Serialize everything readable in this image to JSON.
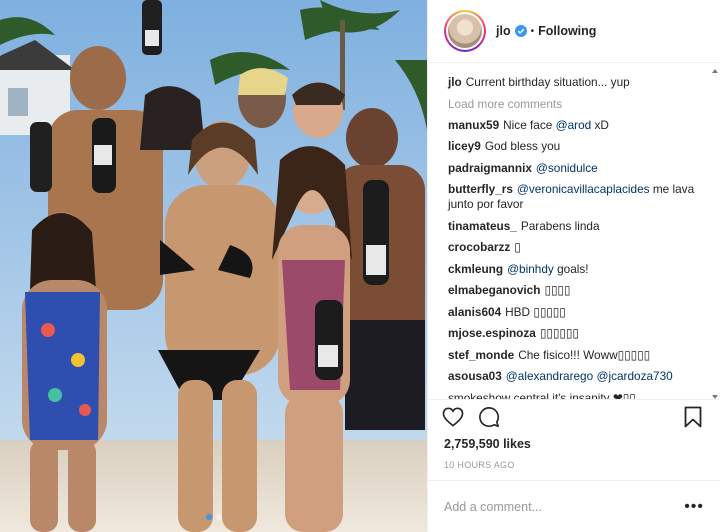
{
  "header": {
    "username": "jlo",
    "separator": "•",
    "follow_status": "Following"
  },
  "caption": {
    "username": "jlo",
    "text": "Current birthday situation... yup"
  },
  "load_more": "Load more comments",
  "comments": [
    {
      "user": "manux59",
      "parts": [
        {
          "t": "Nice face "
        },
        {
          "t": "@arod",
          "m": true
        },
        {
          "t": " xD"
        }
      ]
    },
    {
      "user": "licey9",
      "parts": [
        {
          "t": "God bless you"
        }
      ]
    },
    {
      "user": "padraigmannix",
      "parts": [
        {
          "t": "@sonidulce",
          "m": true
        }
      ]
    },
    {
      "user": "butterfly_rs",
      "parts": [
        {
          "t": "@veronicavillacaplacides",
          "m": true
        },
        {
          "t": " me lava junto por favor"
        }
      ]
    },
    {
      "user": "tinamateus_",
      "parts": [
        {
          "t": "Parabens linda"
        }
      ]
    },
    {
      "user": "crocobarzz",
      "parts": [
        {
          "t": "▯"
        }
      ]
    },
    {
      "user": "ckmleung",
      "parts": [
        {
          "t": "@binhdy",
          "m": true
        },
        {
          "t": " goals!"
        }
      ]
    },
    {
      "user": "elmabeganovich",
      "parts": [
        {
          "t": "▯▯▯▯"
        }
      ]
    },
    {
      "user": "alanis604",
      "parts": [
        {
          "t": "HBD ▯▯▯▯▯"
        }
      ]
    },
    {
      "user": "mjose.espinoza",
      "parts": [
        {
          "t": "▯▯▯▯▯▯"
        }
      ]
    },
    {
      "user": "stef_monde",
      "parts": [
        {
          "t": "Che fisico!!! Woww▯▯▯▯▯"
        }
      ]
    },
    {
      "user": "asousa03",
      "parts": [
        {
          "t": "@alexandrarego",
          "m": true
        },
        {
          "t": " "
        },
        {
          "t": "@jcardoza730",
          "m": true
        }
      ]
    },
    {
      "user": "",
      "parts": [
        {
          "t": "smokeshow central it's insanity ❤▯▯"
        }
      ]
    }
  ],
  "likes": "2,759,590 likes",
  "time": "10 HOURS AGO",
  "add_comment_placeholder": "Add a comment...",
  "more_label": "•••",
  "carousel": {
    "count": 2,
    "active": 0
  },
  "colors": {
    "mention": "#003569",
    "verified": "#3897f0",
    "muted": "#999999"
  },
  "icons": {
    "like": "heart-icon",
    "comment": "comment-icon",
    "save": "bookmark-icon",
    "verified": "verified-badge-icon"
  }
}
